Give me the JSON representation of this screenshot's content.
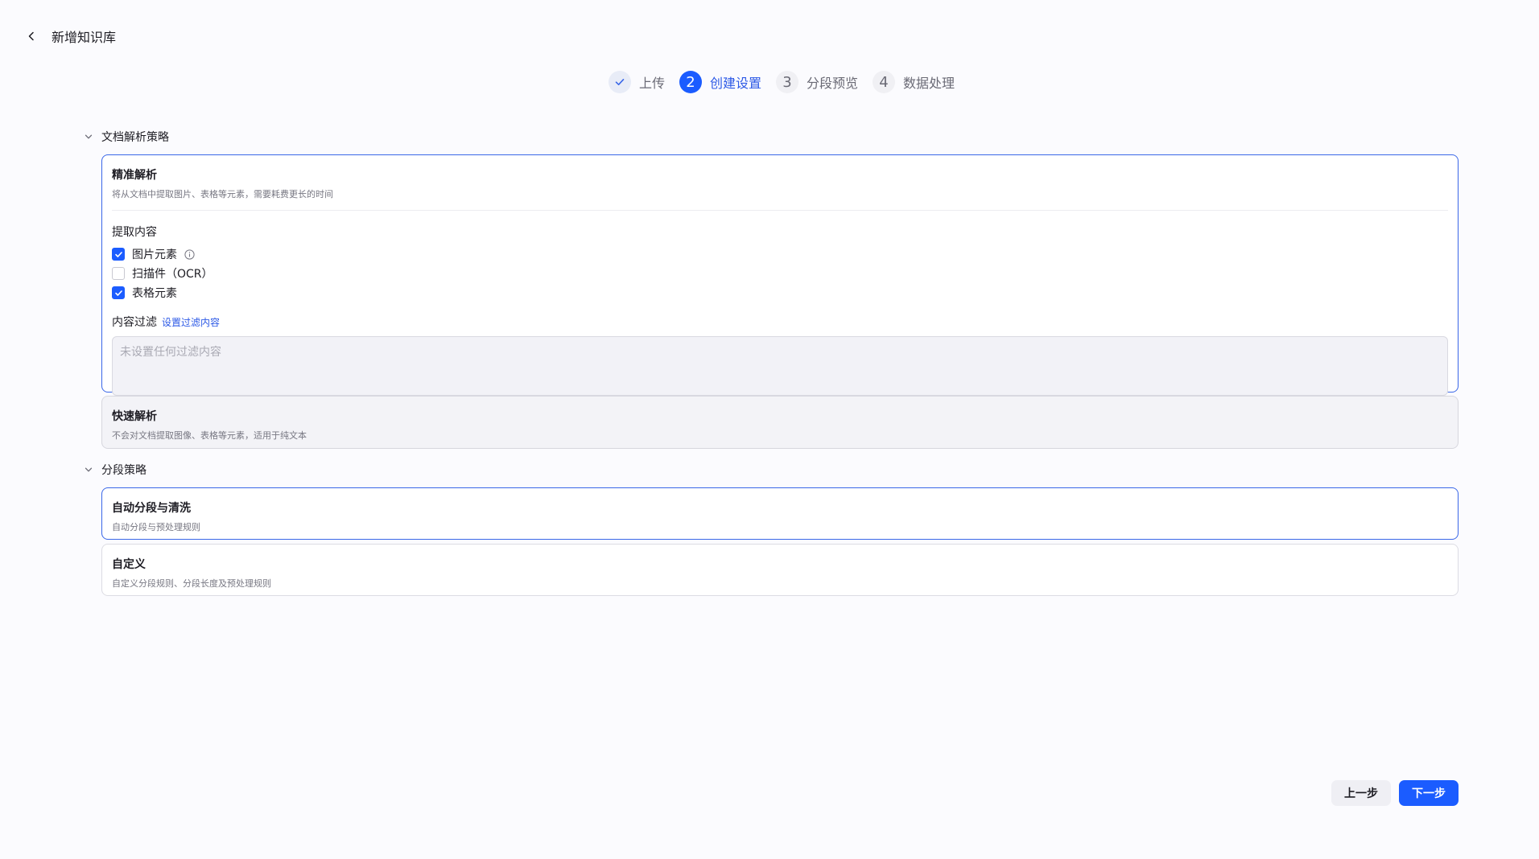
{
  "header": {
    "title": "新增知识库",
    "back_icon": "chevron-left-icon"
  },
  "steps": [
    {
      "label": "上传",
      "state": "done",
      "badge": ""
    },
    {
      "label": "创建设置",
      "state": "active",
      "badge": "2"
    },
    {
      "label": "分段预览",
      "state": "todo",
      "badge": "3"
    },
    {
      "label": "数据处理",
      "state": "todo",
      "badge": "4"
    }
  ],
  "parse_section": {
    "title": "文档解析策略",
    "precise": {
      "title": "精准解析",
      "desc": "将从文档中提取图片、表格等元素，需要耗费更长的时间",
      "extract_title": "提取内容",
      "options": [
        {
          "label": "图片元素",
          "checked": true,
          "info": true
        },
        {
          "label": "扫描件（OCR）",
          "checked": false,
          "info": false
        },
        {
          "label": "表格元素",
          "checked": true,
          "info": false
        }
      ],
      "filter_label": "内容过滤",
      "filter_link": "设置过滤内容",
      "filter_placeholder": "未设置任何过滤内容"
    },
    "fast": {
      "title": "快速解析",
      "desc": "不会对文档提取图像、表格等元素，适用于纯文本"
    }
  },
  "segment_section": {
    "title": "分段策略",
    "auto": {
      "title": "自动分段与清洗",
      "desc": "自动分段与预处理规则"
    },
    "custom": {
      "title": "自定义",
      "desc": "自定义分段规则、分段长度及预处理规则"
    }
  },
  "footer": {
    "prev_label": "上一步",
    "next_label": "下一步"
  },
  "colors": {
    "accent": "#1b5cff",
    "selected_border": "#3a67e8",
    "link": "#2c59e6"
  }
}
